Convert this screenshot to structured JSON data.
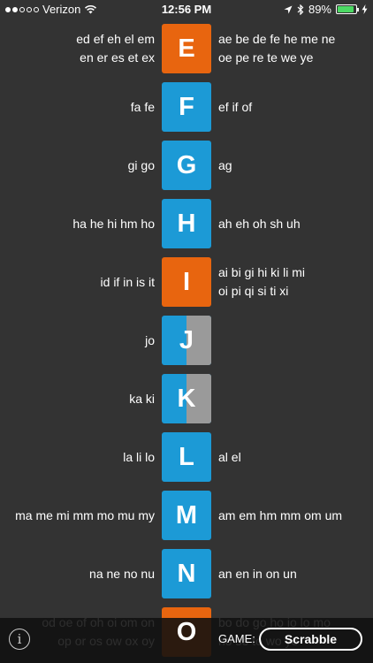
{
  "status_bar": {
    "carrier": "Verizon",
    "time": "12:56 PM",
    "battery": "89%",
    "battery_level": 0.89,
    "battery_color": "#4cd964"
  },
  "colors": {
    "orange": "#e8650f",
    "blue": "#1c9ad6",
    "gray": "#9a9a9a",
    "background": "#333333"
  },
  "rows": [
    {
      "letter": "E",
      "color": "#e8650f",
      "split": false,
      "left": [
        "ed ef eh el em",
        "en er es et ex"
      ],
      "right": [
        "ae be de fe he me ne",
        "oe pe re te we ye"
      ]
    },
    {
      "letter": "F",
      "color": "#1c9ad6",
      "split": false,
      "left": [
        "fa fe"
      ],
      "right": [
        "ef if of"
      ]
    },
    {
      "letter": "G",
      "color": "#1c9ad6",
      "split": false,
      "left": [
        "gi go"
      ],
      "right": [
        "ag"
      ]
    },
    {
      "letter": "H",
      "color": "#1c9ad6",
      "split": false,
      "left": [
        "ha he hi hm ho"
      ],
      "right": [
        "ah eh oh sh uh"
      ]
    },
    {
      "letter": "I",
      "color": "#e8650f",
      "split": false,
      "left": [
        "id if in is it"
      ],
      "right": [
        "ai bi gi hi ki li mi",
        "oi pi qi si ti xi"
      ]
    },
    {
      "letter": "J",
      "color": "#1c9ad6",
      "split": true,
      "left": [
        "jo"
      ],
      "right": []
    },
    {
      "letter": "K",
      "color": "#1c9ad6",
      "split": true,
      "left": [
        "ka ki"
      ],
      "right": []
    },
    {
      "letter": "L",
      "color": "#1c9ad6",
      "split": false,
      "left": [
        "la li lo"
      ],
      "right": [
        "al el"
      ]
    },
    {
      "letter": "M",
      "color": "#1c9ad6",
      "split": false,
      "left": [
        "ma me mi mm mo mu my"
      ],
      "right": [
        "am em hm mm om um"
      ]
    },
    {
      "letter": "N",
      "color": "#1c9ad6",
      "split": false,
      "left": [
        "na ne no nu"
      ],
      "right": [
        "an en in on un"
      ]
    },
    {
      "letter": "O",
      "color": "#e8650f",
      "split": false,
      "left": [
        "od oe of oh oi om on",
        "op or os ow ox oy"
      ],
      "right": [
        "bo do go ho io lo mo",
        "no so to wo yo"
      ]
    }
  ],
  "bottom_bar": {
    "info_icon": "i",
    "game_label": "GAME:",
    "game_value": "Scrabble"
  }
}
